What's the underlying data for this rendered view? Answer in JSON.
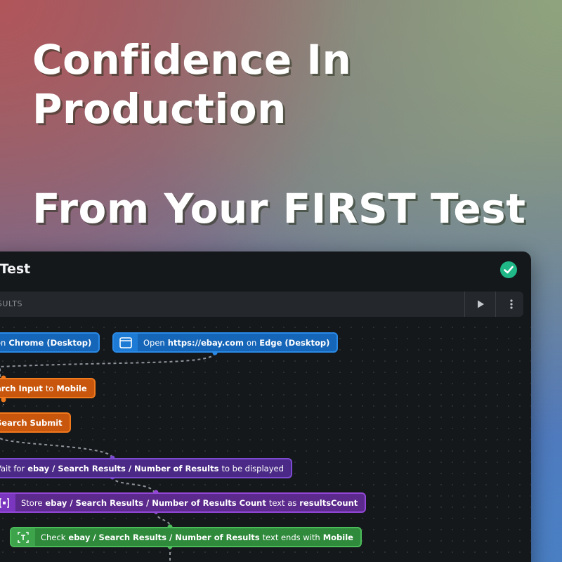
{
  "headline": {
    "line1": "Confidence In",
    "line2": "Production",
    "line3": "From Your FIRST Test"
  },
  "window": {
    "title": "e Test",
    "tab_label": "RESULTS"
  },
  "colors": {
    "blue": "#1565b8",
    "orange": "#c9560d",
    "purple": "#4a2a86",
    "violet": "#5b2a8c",
    "green": "#2f8a3c",
    "check_badge": "#1fb886"
  },
  "icons": {
    "check_badge": "check-badge-icon",
    "play": "play-icon",
    "more": "more-vertical-icon",
    "browser": "browser-window-icon",
    "store": "store-variable-icon",
    "text_check": "text-check-icon"
  },
  "nodes": {
    "n1": {
      "p1": "on",
      "p2": "Chrome (Desktop)"
    },
    "n2": {
      "p1": "Open",
      "p2": "https://ebay.com",
      "p3": "on",
      "p4": "Edge (Desktop)"
    },
    "n3": {
      "p1": "arch Input",
      "p2": "to",
      "p3": "Mobile"
    },
    "n4": {
      "p1": "Search Submit"
    },
    "n5": {
      "p1": "Vait for",
      "p2": "ebay / Search Results / Number of Results",
      "p3": "to be displayed"
    },
    "n6": {
      "p1": "Store",
      "p2": "ebay / Search Results / Number of Results Count",
      "p3": "text as",
      "p4": "resultsCount"
    },
    "n7": {
      "p1": "Check",
      "p2": "ebay / Search Results / Number of Results",
      "p3": "text ends with",
      "p4": "Mobile"
    }
  }
}
